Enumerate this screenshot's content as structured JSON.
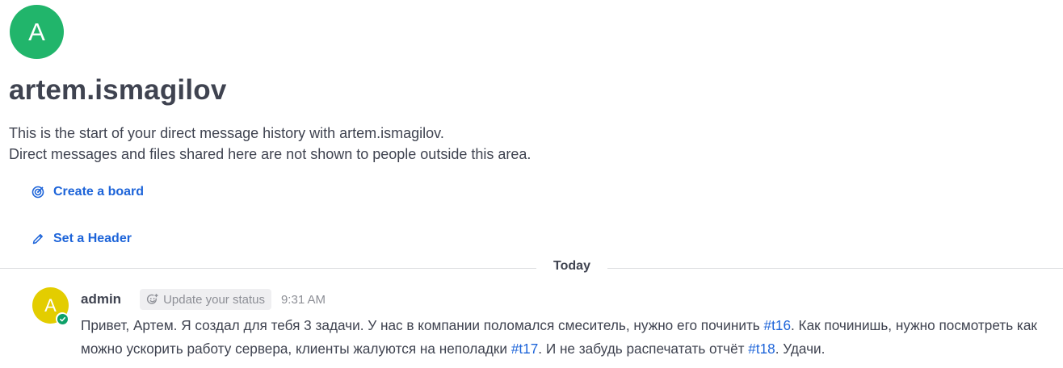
{
  "intro": {
    "avatar_letter": "A",
    "avatar_color": "#21b56b",
    "name": "artem.ismagilov",
    "line1": "This is the start of your direct message history with artem.ismagilov.",
    "line2": "Direct messages and files shared here are not shown to people outside this area."
  },
  "actions": {
    "create_board": {
      "label": "Create a board",
      "icon": "board-target-icon"
    },
    "set_header": {
      "label": "Set a Header",
      "icon": "pencil-icon"
    }
  },
  "date_separator": "Today",
  "post": {
    "avatar_letter": "A",
    "avatar_color": "#e3cd00",
    "status": "online",
    "username": "admin",
    "status_button": "Update your status",
    "time": "9:31 AM",
    "message": {
      "part1": "Привет, Артем. Я создал для тебя 3 задачи. У нас в компании поломался смеситель, нужно его починить ",
      "tag1": "#t16",
      "part2": ". Как починишь, нужно посмотреть как можно ускорить работу сервера, клиенты жалуются на неполадки ",
      "tag2": "#t17",
      "part3": ". И не забудь распечатать отчёт ",
      "tag3": "#t18",
      "part4": ". Удачи."
    }
  },
  "colors": {
    "link": "#1d64d9",
    "text": "#3f4350",
    "muted": "#8d8f96",
    "online": "#0ea169"
  }
}
